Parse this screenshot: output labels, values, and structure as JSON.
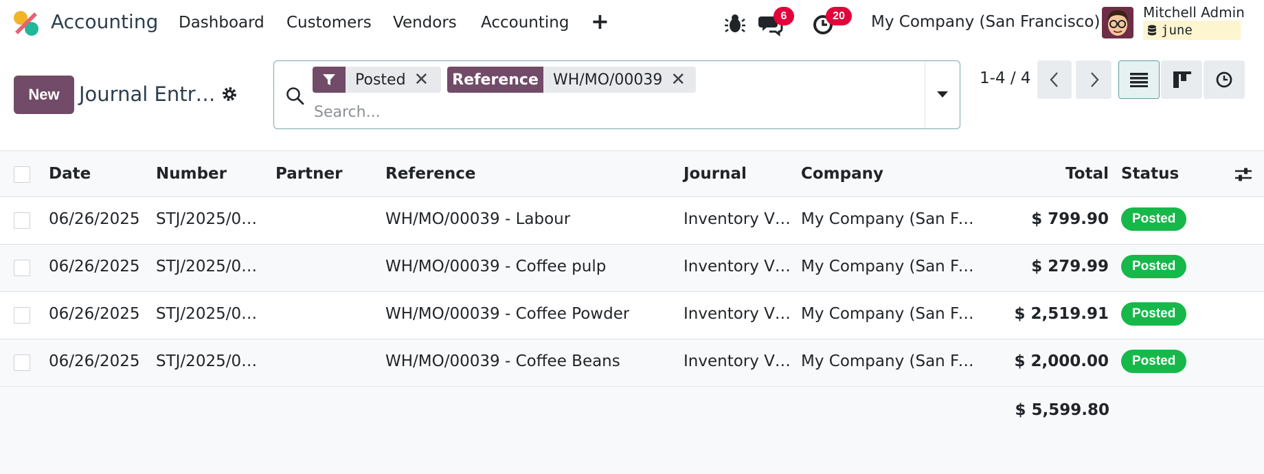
{
  "navbar": {
    "app_title": "Accounting",
    "menu": [
      "Dashboard",
      "Customers",
      "Vendors",
      "Accounting"
    ],
    "messages_count": "6",
    "activities_count": "20",
    "company": "My Company (San Francisco)",
    "user_name": "Mitchell Admin",
    "database": "june"
  },
  "control_panel": {
    "new_label": "New",
    "breadcrumb": "Journal Entr…",
    "facets": [
      {
        "label": "",
        "value": "Posted"
      },
      {
        "label": "Reference",
        "value": "WH/MO/00039"
      }
    ],
    "search_placeholder": "Search...",
    "pager": "1-4 / 4"
  },
  "table": {
    "columns": [
      "Date",
      "Number",
      "Partner",
      "Reference",
      "Journal",
      "Company",
      "Total",
      "Status"
    ],
    "rows": [
      {
        "date": "06/26/2025",
        "number": "STJ/2025/0…",
        "partner": "",
        "reference": "WH/MO/00039 - Labour",
        "journal": "Inventory V…",
        "company": "My Company (San Fr…",
        "total": "$ 799.90",
        "status": "Posted"
      },
      {
        "date": "06/26/2025",
        "number": "STJ/2025/0…",
        "partner": "",
        "reference": "WH/MO/00039 - Coffee pulp",
        "journal": "Inventory V…",
        "company": "My Company (San Fr…",
        "total": "$ 279.99",
        "status": "Posted"
      },
      {
        "date": "06/26/2025",
        "number": "STJ/2025/0…",
        "partner": "",
        "reference": "WH/MO/00039 - Coffee Powder",
        "journal": "Inventory V…",
        "company": "My Company (San Fr…",
        "total": "$ 2,519.91",
        "status": "Posted"
      },
      {
        "date": "06/26/2025",
        "number": "STJ/2025/0…",
        "partner": "",
        "reference": "WH/MO/00039 - Coffee Beans",
        "journal": "Inventory V…",
        "company": "My Company (San Fr…",
        "total": "$ 2,000.00",
        "status": "Posted"
      }
    ],
    "grand_total": "$ 5,599.80"
  },
  "colors": {
    "brand": "#714b67",
    "status_posted": "#16b84a",
    "badge_red": "#e4003a"
  }
}
